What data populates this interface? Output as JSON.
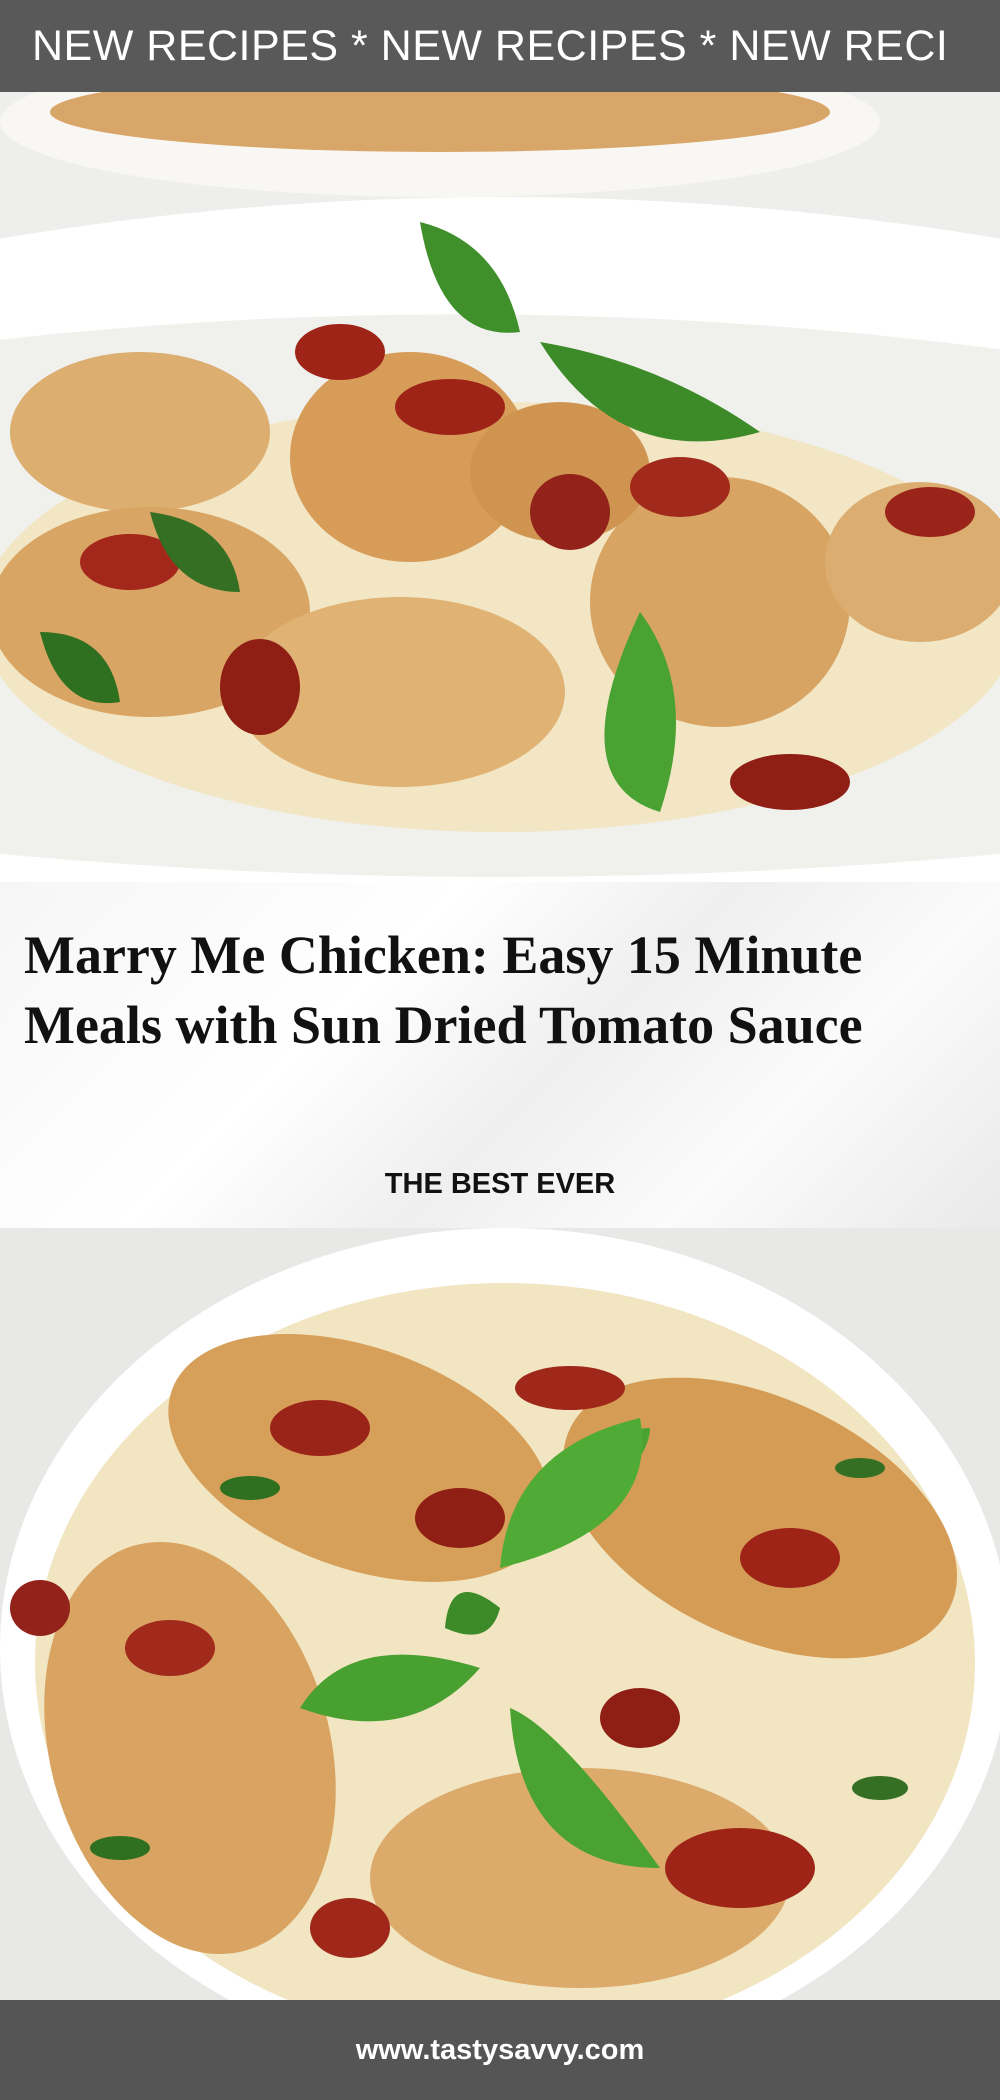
{
  "banner": {
    "text": "NEW RECIPES * NEW RECIPES * NEW  RECI"
  },
  "headline": {
    "title": "Marry Me Chicken: Easy 15 Minute Meals with Sun Dried Tomato Sauce",
    "subtitle": "THE BEST EVER"
  },
  "footer": {
    "url": "www.tastysavvy.com"
  },
  "colors": {
    "banner_bg": "#595959",
    "footer_bg": "#555555",
    "sauce": "#efe3c0",
    "chicken": "#d8a25c",
    "sun_dried_tomato": "#9e2418",
    "basil": "#3f8f2a"
  }
}
